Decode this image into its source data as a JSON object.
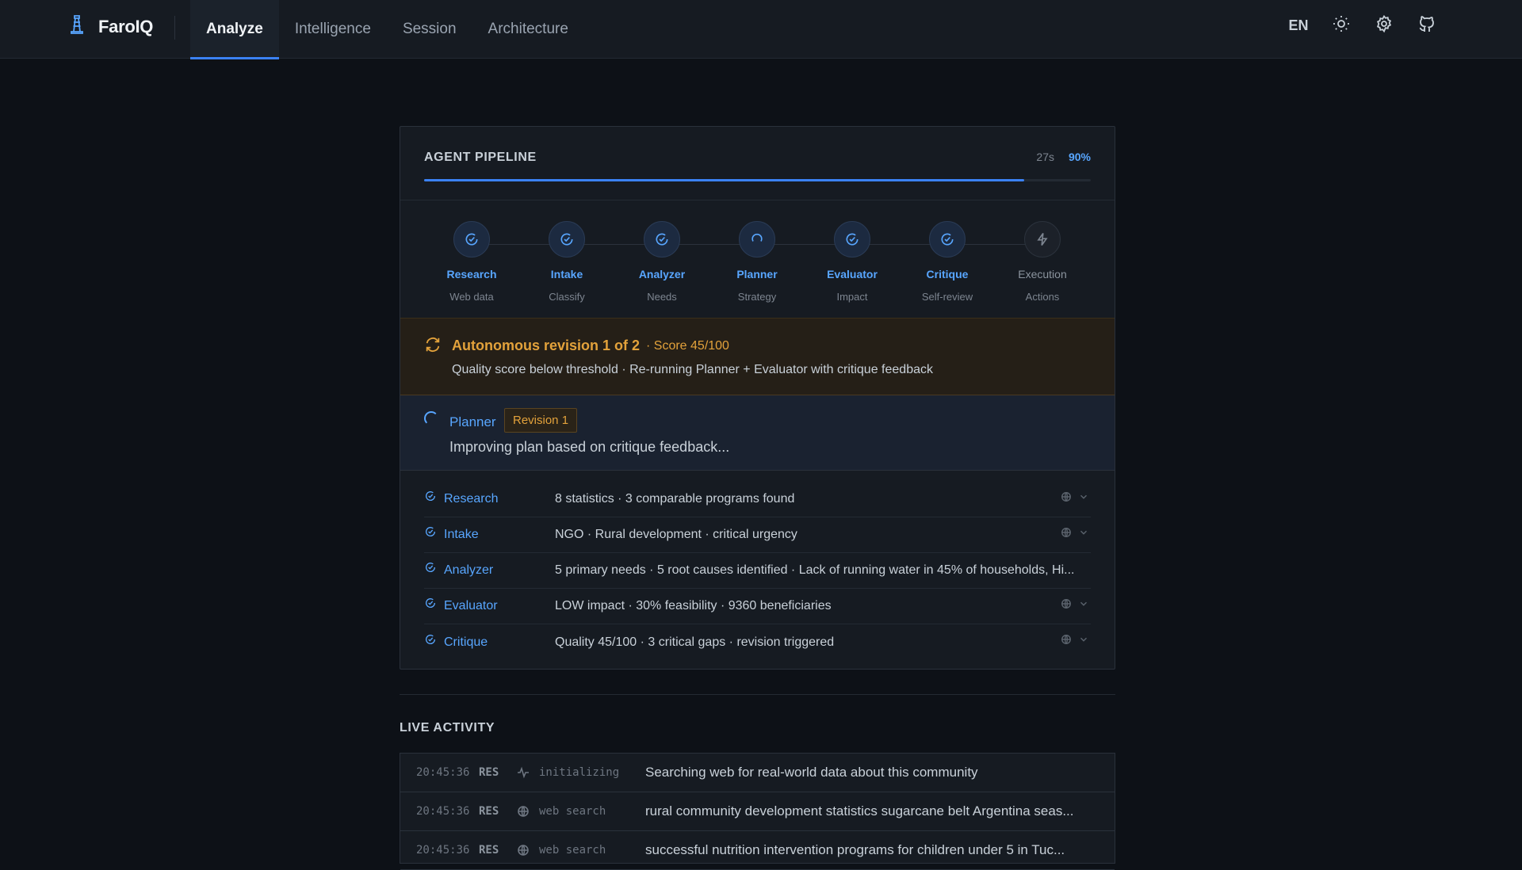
{
  "app": {
    "name": "FaroIQ"
  },
  "nav": {
    "tabs": [
      {
        "label": "Analyze",
        "active": true
      },
      {
        "label": "Intelligence",
        "active": false
      },
      {
        "label": "Session",
        "active": false
      },
      {
        "label": "Architecture",
        "active": false
      }
    ]
  },
  "top_actions": {
    "language": "EN",
    "icons": [
      "sun-icon",
      "gear-icon",
      "github-icon"
    ]
  },
  "pipeline": {
    "title": "AGENT PIPELINE",
    "elapsed": "27s",
    "percent_label": "90%",
    "progress": 0.9,
    "steps": [
      {
        "name": "Research",
        "sub": "Web data",
        "state": "done"
      },
      {
        "name": "Intake",
        "sub": "Classify",
        "state": "done"
      },
      {
        "name": "Analyzer",
        "sub": "Needs",
        "state": "done"
      },
      {
        "name": "Planner",
        "sub": "Strategy",
        "state": "running"
      },
      {
        "name": "Evaluator",
        "sub": "Impact",
        "state": "done"
      },
      {
        "name": "Critique",
        "sub": "Self-review",
        "state": "done"
      },
      {
        "name": "Execution",
        "sub": "Actions",
        "state": "pending"
      }
    ],
    "revision": {
      "title": "Autonomous revision 1 of 2",
      "score": "· Score 45/100",
      "description": "Quality score below threshold · Re-running Planner + Evaluator with critique feedback"
    },
    "running": {
      "agent": "Planner",
      "badge": "Revision 1",
      "description": "Improving plan based on critique feedback..."
    },
    "results": [
      {
        "name": "Research",
        "text": "8 statistics · 3 comparable programs found",
        "actions": true
      },
      {
        "name": "Intake",
        "text": "NGO · Rural development · critical urgency",
        "actions": true
      },
      {
        "name": "Analyzer",
        "text": "5 primary needs · 5 root causes identified · Lack of running water in 45% of households, Hi...",
        "actions": false
      },
      {
        "name": "Evaluator",
        "text": "LOW impact · 30% feasibility · 9360 beneficiaries",
        "actions": true
      },
      {
        "name": "Critique",
        "text": "Quality 45/100 · 3 critical gaps · revision triggered",
        "actions": true
      }
    ]
  },
  "activity": {
    "title": "LIVE ACTIVITY",
    "rows": [
      {
        "time": "20:45:36",
        "code": "RES",
        "icon": "pulse-icon",
        "kind": "initializing",
        "message": "Searching web for real-world data about this community"
      },
      {
        "time": "20:45:36",
        "code": "RES",
        "icon": "globe-icon",
        "kind": "web search",
        "message": "rural community development statistics sugarcane belt Argentina seas..."
      },
      {
        "time": "20:45:36",
        "code": "RES",
        "icon": "globe-icon",
        "kind": "web search",
        "message": "successful nutrition intervention programs for children under 5 in Tuc..."
      }
    ]
  },
  "colors": {
    "accent": "#3b82f6",
    "link": "#58a6ff",
    "warning": "#e3a23b",
    "background": "#0d1117",
    "surface": "#161b22"
  }
}
